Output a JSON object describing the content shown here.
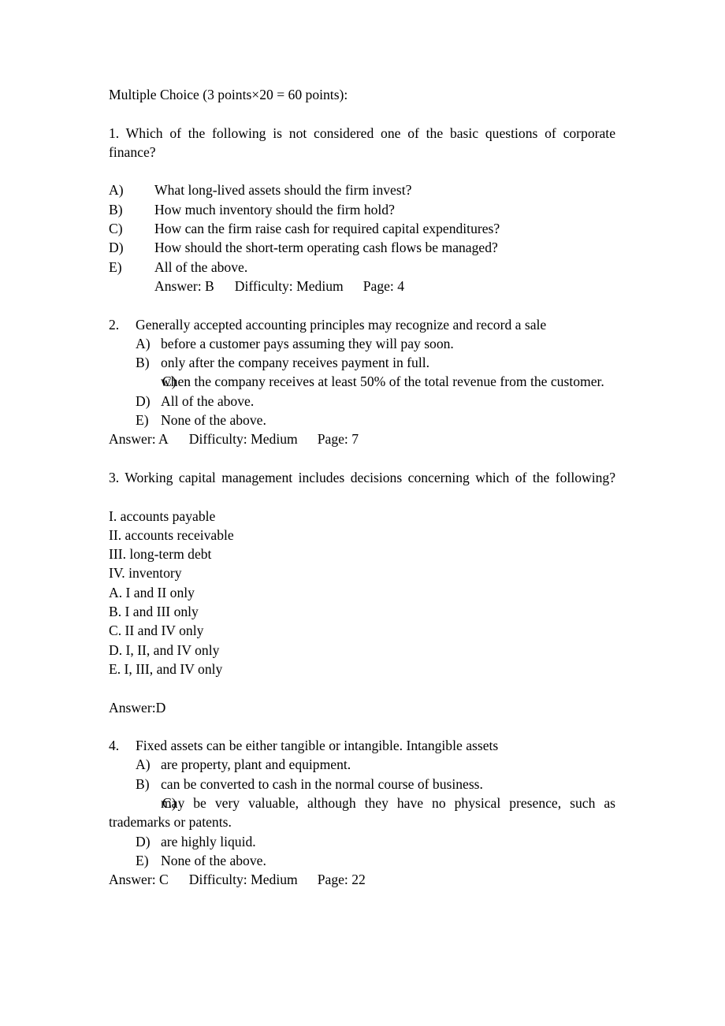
{
  "document": {
    "heading": "Multiple Choice (3 points×20 = 60 points):",
    "questions": [
      {
        "number": "1.",
        "stem": "1. Which of the following is not considered one of the basic questions of corporate finance?",
        "options": [
          {
            "label": "A)",
            "text": "What long-lived assets should the firm invest?"
          },
          {
            "label": "B)",
            "text": "How much inventory should the firm hold?"
          },
          {
            "label": "C)",
            "text": "How can the firm raise cash for required capital expenditures?"
          },
          {
            "label": "D)",
            "text": "How should the short-term operating cash flows be managed?"
          },
          {
            "label": "E)",
            "text": "All of the above."
          }
        ],
        "answer_label": "Answer: B",
        "difficulty_label": "Difficulty: Medium",
        "page_label": "Page: 4"
      },
      {
        "number": "2.",
        "stem": "Generally accepted accounting principles may recognize and record a sale",
        "options": [
          {
            "label": "A)",
            "text": "before a customer pays assuming they will pay soon."
          },
          {
            "label": "B)",
            "text": "only after the company receives payment in full."
          },
          {
            "label": "C)",
            "text": "when the company receives at least 50% of the total revenue from the customer."
          },
          {
            "label": "D)",
            "text": "All of the above."
          },
          {
            "label": "E)",
            "text": "None of the above."
          }
        ],
        "answer_label": "Answer: A",
        "difficulty_label": "Difficulty: Medium",
        "page_label": "Page: 7"
      },
      {
        "number": "3.",
        "stem": "3. Working capital management includes decisions concerning which of the following?",
        "romans": [
          "I. accounts payable",
          "II. accounts receivable",
          "III. long-term debt",
          "IV. inventory"
        ],
        "options": [
          "A. I and II only",
          "B. I and III only",
          "C. II and IV only",
          "D. I, II, and IV only",
          "E. I, III, and IV only"
        ],
        "answer_label": "Answer:D"
      },
      {
        "number": "4.",
        "stem": "Fixed assets can be either tangible or intangible. Intangible assets",
        "options": [
          {
            "label": "A)",
            "text": "are property, plant and equipment."
          },
          {
            "label": "B)",
            "text": "can be converted to cash in the normal course of business."
          },
          {
            "label": "C)",
            "text": "may be very valuable, although they have no physical presence, such as trademarks or patents."
          },
          {
            "label": "D)",
            "text": "are highly liquid."
          },
          {
            "label": "E)",
            "text": "None of the above."
          }
        ],
        "answer_label": "Answer: C",
        "difficulty_label": "Difficulty: Medium",
        "page_label": "Page: 22"
      }
    ]
  },
  "colors": {
    "text": "#000000",
    "background": "#ffffff"
  }
}
